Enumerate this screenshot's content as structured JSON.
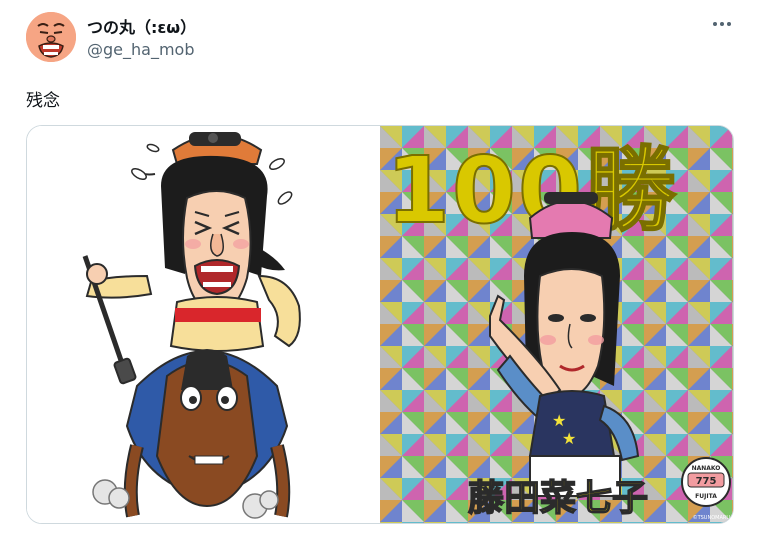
{
  "tweet": {
    "display_name": "つの丸（:εω）",
    "handle": "@ge_ha_mob",
    "text": "残念"
  },
  "card": {
    "headline": "100勝",
    "name": "藤田菜七子",
    "badge_top": "NANAKO",
    "badge_number": "775",
    "badge_bottom": "FUJITA",
    "credit": "©TSUNOMARU"
  },
  "colors": {
    "handle_gray": "#536471",
    "border": "#cfd9de",
    "gold": "#d9c800"
  }
}
